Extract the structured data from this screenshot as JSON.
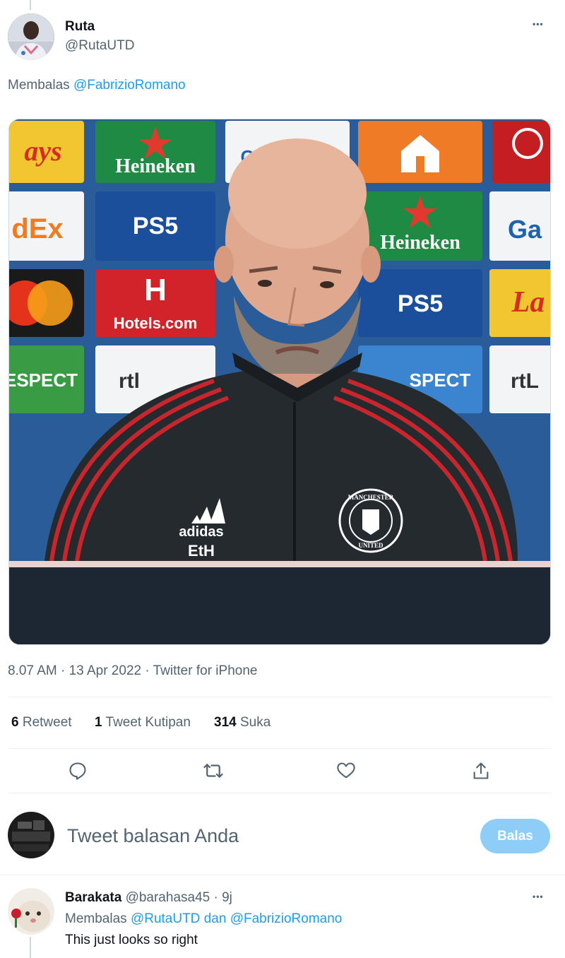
{
  "tweet": {
    "author_name": "Ruta",
    "author_handle": "@RutaUTD",
    "more_label": "•••",
    "replying_prefix": "Membalas",
    "replying_to": "@FabrizioRomano",
    "timestamp": "8.07 AM · 13 Apr 2022 · Twitter for iPhone",
    "stats": {
      "retweets_count": "6",
      "retweets_label": "Retweet",
      "quotes_count": "1",
      "quotes_label": "Tweet Kutipan",
      "likes_count": "314",
      "likes_label": "Suka"
    },
    "actions": [
      "reply-icon",
      "retweet-icon",
      "like-icon",
      "share-icon"
    ]
  },
  "compose": {
    "placeholder": "Tweet balasan Anda",
    "button_label": "Balas",
    "button_color": "#8ecdf8"
  },
  "reply": {
    "author_name": "Barakata",
    "author_handle": "@barahasa45",
    "time": "· 9j",
    "more_label": "•••",
    "replying_prefix": "Membalas",
    "replying_to_1": "@RutaUTD",
    "replying_and": "dan",
    "replying_to_2": "@FabrizioRomano",
    "text": "This just looks so right"
  },
  "sponsor_board": {
    "logos": [
      "ays",
      "Heineken",
      "GAZPROM",
      "dEx",
      "PS5",
      "Heineken",
      "Ga",
      "Hotels.com",
      "PS5",
      "La",
      "ESPECT",
      "rtl",
      "SPECT",
      "rtL"
    ],
    "jacket_text": [
      "adidas",
      "EtH"
    ],
    "badge_text": [
      "MANCHESTER",
      "UNITED"
    ]
  },
  "colors": {
    "link": "#1d9bf0",
    "muted": "#536471",
    "text": "#0f1419"
  }
}
